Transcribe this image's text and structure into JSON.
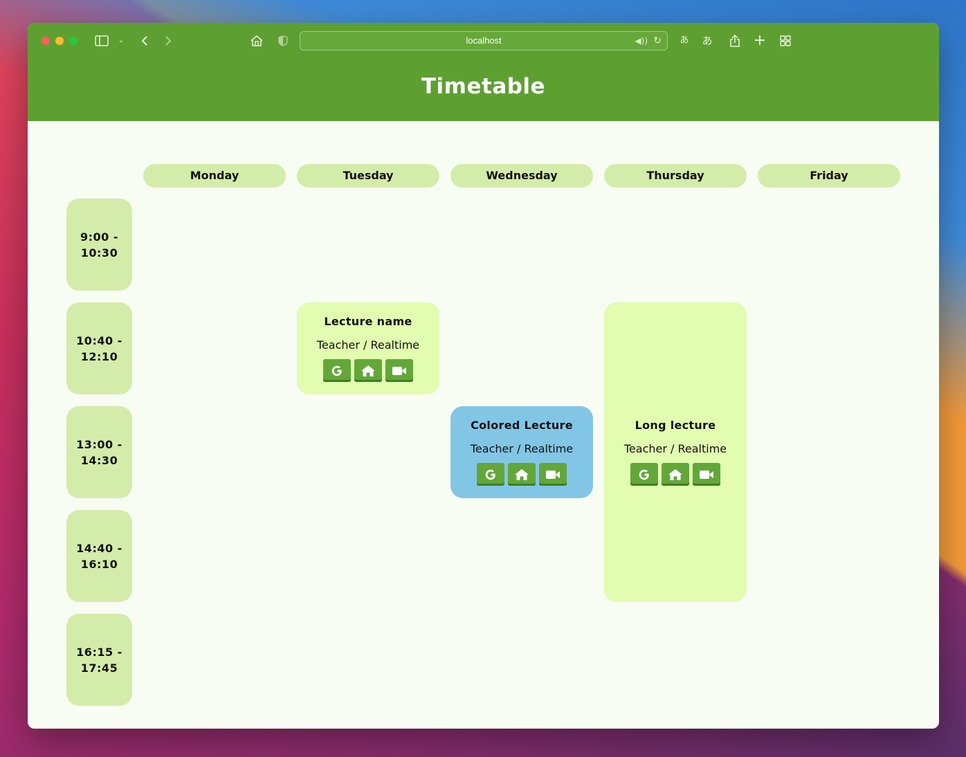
{
  "browser": {
    "url": "localhost",
    "translate_label_1": "あ",
    "translate_label_2": "あ"
  },
  "page": {
    "title": "Timetable"
  },
  "days": [
    "Monday",
    "Tuesday",
    "Wednesday",
    "Thursday",
    "Friday"
  ],
  "times": [
    "9:00 -\n10:30",
    "10:40 -\n12:10",
    "13:00 -\n14:30",
    "14:40 -\n16:10",
    "16:15 -\n17:45"
  ],
  "lectures": [
    {
      "name": "Lecture name",
      "info": "Teacher / Realtime",
      "day": "Tuesday",
      "time": "10:40 -\n12:10",
      "color": "#e2fcb0",
      "buttons": [
        "google-icon",
        "home-icon",
        "video-camera-icon"
      ]
    },
    {
      "name": "Colored Lecture",
      "info": "Teacher / Realtime",
      "day": "Wednesday",
      "time": "13:00 -\n14:30",
      "color": "#82c6e6",
      "buttons": [
        "google-icon",
        "home-icon",
        "video-camera-icon"
      ]
    },
    {
      "name": "Long lecture",
      "info": "Teacher / Realtime",
      "day": "Thursday",
      "time": "10:40 -\n12:10 to 14:40 -\n16:10",
      "color": "#e2fcb0",
      "buttons": [
        "google-icon",
        "home-icon",
        "video-camera-icon"
      ]
    }
  ],
  "theme": {
    "primary": "#5e9f32",
    "cell": "#d4ecaa",
    "lecture": "#e2fcb0",
    "accent_lecture": "#82c6e6",
    "background": "#f8fdf4"
  }
}
